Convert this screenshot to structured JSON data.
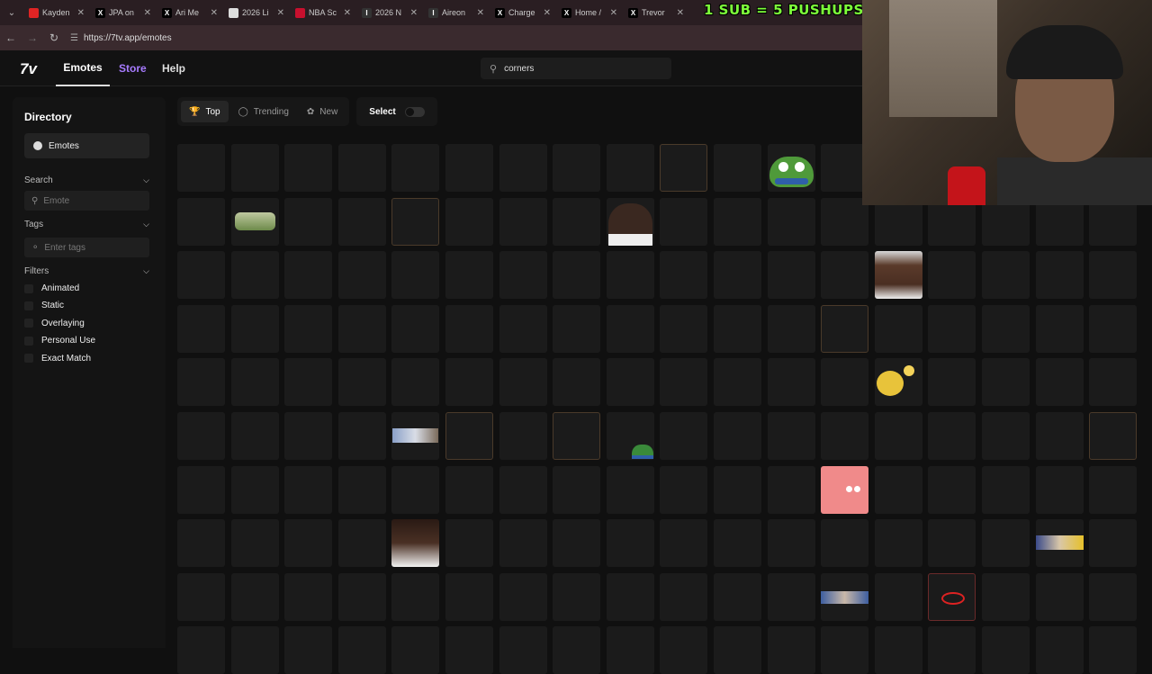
{
  "browser": {
    "tabs": [
      {
        "label": "Kayden",
        "icon": "youtube-icon",
        "color": "#e02424"
      },
      {
        "label": "JPA on",
        "icon": "x-icon",
        "color": "#000000"
      },
      {
        "label": "Ari Me",
        "icon": "x-icon",
        "color": "#000000"
      },
      {
        "label": "2026 Li",
        "icon": "page-icon",
        "color": "#dddddd"
      },
      {
        "label": "NBA Sc",
        "icon": "nba-icon",
        "color": "#c8102e"
      },
      {
        "label": "2026 N",
        "icon": "italic-icon",
        "color": "#333333"
      },
      {
        "label": "Aireon",
        "icon": "italic-icon",
        "color": "#333333"
      },
      {
        "label": "Charge",
        "icon": "x-icon",
        "color": "#000000"
      },
      {
        "label": "Home /",
        "icon": "x-icon",
        "color": "#000000"
      },
      {
        "label": "Trevor",
        "icon": "x-icon",
        "color": "#000000"
      }
    ],
    "url": "https://7tv.app/emotes"
  },
  "overlay_banner": "1 SUB = 5 PUSHUPS",
  "header": {
    "logo": "7v",
    "nav": {
      "emotes": "Emotes",
      "store": "Store",
      "help": "Help"
    },
    "search_value": "corners"
  },
  "sidebar": {
    "title": "Directory",
    "emotes_label": "Emotes",
    "search_label": "Search",
    "search_placeholder": "Emote",
    "tags_label": "Tags",
    "tags_placeholder": "Enter tags",
    "filters_label": "Filters",
    "filters": [
      "Animated",
      "Static",
      "Overlaying",
      "Personal Use",
      "Exact Match"
    ]
  },
  "toolbar": {
    "top": "Top",
    "trending": "Trending",
    "new": "New",
    "select": "Select"
  },
  "grid": {
    "columns": 18,
    "rows": 10,
    "emotes": [
      {
        "row": 0,
        "col": 11,
        "name": "pepe-frog-emote"
      },
      {
        "row": 1,
        "col": 1,
        "name": "money-stack-emote"
      },
      {
        "row": 1,
        "col": 8,
        "name": "man-face-emote"
      },
      {
        "row": 2,
        "col": 13,
        "name": "laughing-man-emote"
      },
      {
        "row": 4,
        "col": 13,
        "name": "waving-smiley-emote"
      },
      {
        "row": 5,
        "col": 4,
        "name": "lying-man-emote"
      },
      {
        "row": 5,
        "col": 8,
        "name": "small-pepe-emote"
      },
      {
        "row": 6,
        "col": 12,
        "name": "patrick-star-emote"
      },
      {
        "row": 7,
        "col": 4,
        "name": "sleeping-man-emote"
      },
      {
        "row": 7,
        "col": 16,
        "name": "banner-strip-emote"
      },
      {
        "row": 8,
        "col": 12,
        "name": "player-clip-emote"
      },
      {
        "row": 8,
        "col": 14,
        "name": "red-circle-arrow-emote"
      }
    ],
    "highlight_cells": [
      {
        "row": 0,
        "col": 9
      },
      {
        "row": 1,
        "col": 4
      },
      {
        "row": 3,
        "col": 12
      },
      {
        "row": 5,
        "col": 5
      },
      {
        "row": 5,
        "col": 7
      },
      {
        "row": 5,
        "col": 17
      }
    ]
  },
  "colors": {
    "accent": "#a77bff",
    "banner": "#7dff3a",
    "background": "#101010"
  }
}
